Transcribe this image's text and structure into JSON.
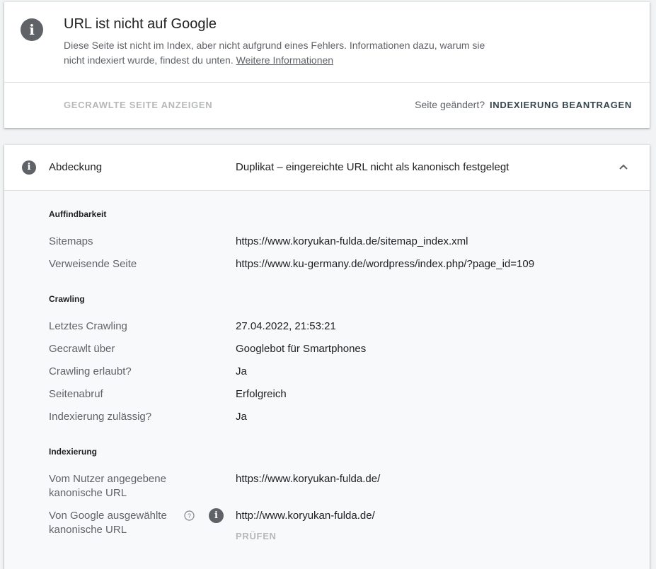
{
  "status": {
    "title": "URL ist nicht auf Google",
    "description": "Diese Seite ist nicht im Index, aber nicht aufgrund eines Fehlers. Informationen dazu, warum sie nicht indexiert wurde, findest du unten.",
    "more_info_link": "Weitere Informationen",
    "icon": "info-icon"
  },
  "actions": {
    "view_crawled": "GECRAWLTE SEITE ANZEIGEN",
    "changed_question": "Seite geändert?",
    "request_indexing": "INDEXIERUNG BEANTRAGEN"
  },
  "coverage": {
    "label": "Abdeckung",
    "value": "Duplikat – eingereichte URL nicht als kanonisch festgelegt",
    "expanded_icon": "chevron-up-icon",
    "sections": {
      "discovery": {
        "title": "Auffindbarkeit",
        "rows": [
          {
            "label": "Sitemaps",
            "value": "https://www.koryukan-fulda.de/sitemap_index.xml"
          },
          {
            "label": "Verweisende Seite",
            "value": "https://www.ku-germany.de/wordpress/index.php/?page_id=109"
          }
        ]
      },
      "crawling": {
        "title": "Crawling",
        "rows": [
          {
            "label": "Letztes Crawling",
            "value": "27.04.2022, 21:53:21"
          },
          {
            "label": "Gecrawlt über",
            "value": "Googlebot für Smartphones"
          },
          {
            "label": "Crawling erlaubt?",
            "value": "Ja"
          },
          {
            "label": "Seitenabruf",
            "value": "Erfolgreich"
          },
          {
            "label": "Indexierung zulässig?",
            "value": "Ja"
          }
        ]
      },
      "indexing": {
        "title": "Indexierung",
        "rows": [
          {
            "label": "Vom Nutzer angegebene kanonische URL",
            "value": "https://www.koryukan-fulda.de/"
          },
          {
            "label": "Von Google ausgewählte kanonische URL",
            "value": "http://www.koryukan-fulda.de/"
          }
        ],
        "check_button": "PRÜFEN"
      }
    }
  }
}
